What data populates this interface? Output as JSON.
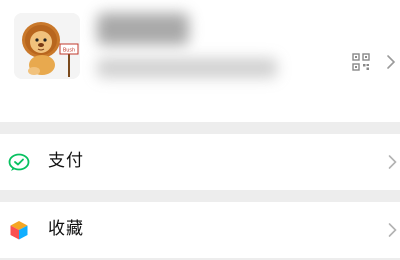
{
  "profile": {
    "name_blurred": true,
    "id_blurred": true,
    "avatar_sign_text": "Bush",
    "qr_icon": "qr-code-icon",
    "chevron_icon": "chevron-right-icon"
  },
  "menu": {
    "items": [
      {
        "label": "支付",
        "icon": "pay-icon",
        "color": "#07c160"
      },
      {
        "label": "收藏",
        "icon": "favorites-cube-icon",
        "color": "#f5a623"
      }
    ]
  },
  "colors": {
    "background": "#ededed",
    "pay_green": "#07c160"
  }
}
